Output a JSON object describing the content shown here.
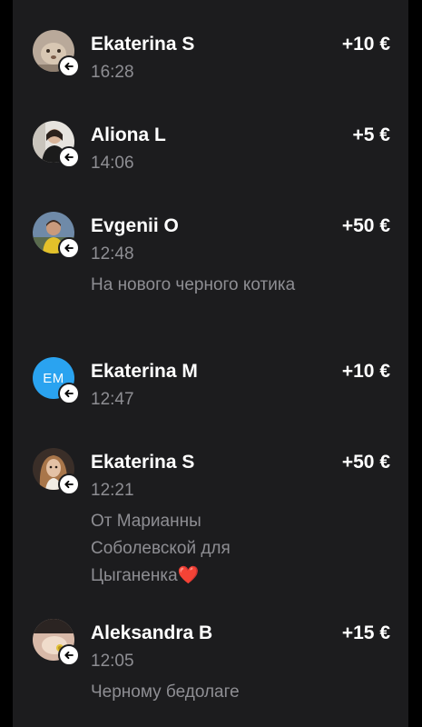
{
  "transactions": [
    {
      "name": "Ekaterina S",
      "time": "16:28",
      "amount": "+10 €",
      "comment": "",
      "avatar": "photo",
      "direction_icon": "incoming-arrow-icon"
    },
    {
      "name": "Aliona L",
      "time": "14:06",
      "amount": "+5 €",
      "comment": "",
      "avatar": "photo",
      "direction_icon": "incoming-arrow-icon"
    },
    {
      "name": "Evgenii O",
      "time": "12:48",
      "amount": "+50 €",
      "comment": "На нового черного котика",
      "avatar": "photo",
      "direction_icon": "incoming-arrow-icon"
    },
    {
      "name": "Ekaterina M",
      "time": "12:47",
      "amount": "+10 €",
      "comment": "",
      "avatar_initials": "EM",
      "avatar_color": "#2aa3f0",
      "direction_icon": "incoming-arrow-icon"
    },
    {
      "name": "Ekaterina S",
      "time": "12:21",
      "amount": "+50 €",
      "comment": "От Марианны Соболевской для Цыганенка",
      "comment_emoji": "❤️",
      "avatar": "photo",
      "direction_icon": "incoming-arrow-icon"
    },
    {
      "name": "Aleksandra B",
      "time": "12:05",
      "amount": "+15 €",
      "comment": "Черному бедолаге",
      "avatar": "photo",
      "direction_icon": "incoming-arrow-icon"
    }
  ],
  "colors": {
    "background": "#1c1c1e",
    "primary_text": "#ffffff",
    "secondary_text": "#8e8e93"
  }
}
